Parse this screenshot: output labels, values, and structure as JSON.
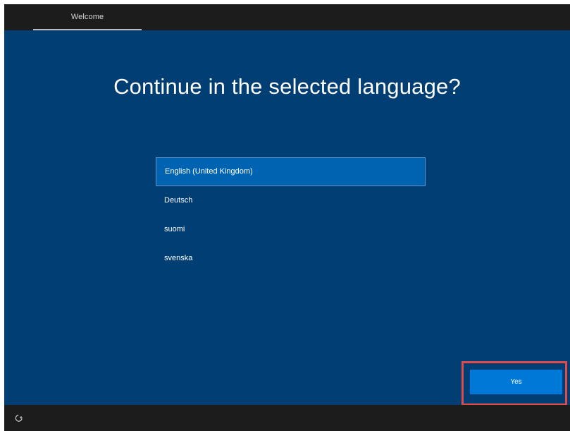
{
  "header": {
    "tab_label": "Welcome"
  },
  "main": {
    "title": "Continue in the selected language?",
    "languages": [
      {
        "label": "English (United Kingdom)",
        "selected": true
      },
      {
        "label": "Deutsch",
        "selected": false
      },
      {
        "label": "suomi",
        "selected": false
      },
      {
        "label": "svenska",
        "selected": false
      }
    ],
    "yes_label": "Yes"
  },
  "footer": {
    "icon": "accessibility-icon"
  },
  "colors": {
    "background": "#003e73",
    "selected_item": "#0063b1",
    "button": "#0078d7",
    "highlight": "#e14a4b"
  }
}
